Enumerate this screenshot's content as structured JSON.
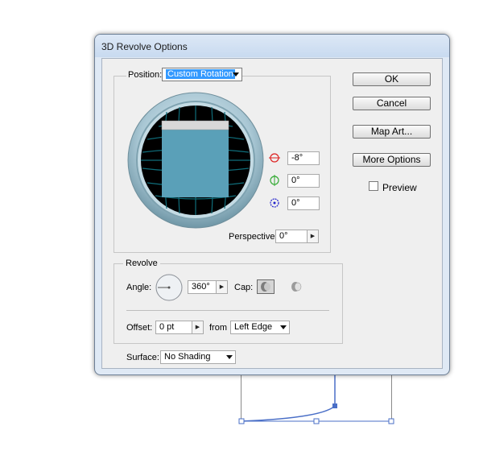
{
  "dialog": {
    "title": "3D Revolve Options",
    "position": {
      "label": "Position:",
      "value": "Custom Rotation"
    },
    "rotation": {
      "x": "-8°",
      "y": "0°",
      "z": "0°"
    },
    "perspective": {
      "label": "Perspective:",
      "value": "0°"
    },
    "revolve": {
      "legend": "Revolve",
      "angle_label": "Angle:",
      "angle_value": "360°",
      "cap_label": "Cap:",
      "offset_label": "Offset:",
      "offset_value": "0 pt",
      "from_label": "from",
      "from_value": "Left Edge"
    },
    "surface": {
      "label": "Surface:",
      "value": "No Shading"
    },
    "buttons": {
      "ok": "OK",
      "cancel": "Cancel",
      "map_art": "Map Art...",
      "more_options": "More Options"
    },
    "preview": {
      "label": "Preview",
      "checked": false
    }
  },
  "colors": {
    "selection": "#3399ff",
    "cube_face": "#5aa0b8",
    "grid": "#0f6d7a"
  }
}
